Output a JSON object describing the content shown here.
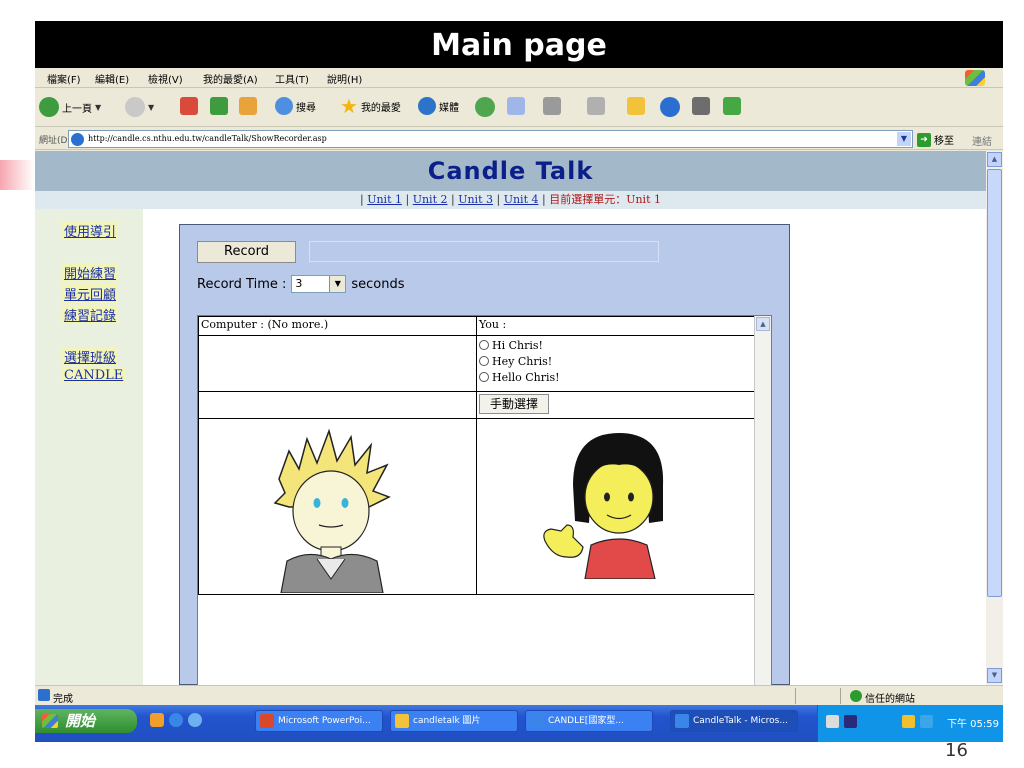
{
  "slide": {
    "title": "Main page",
    "page_number": "16"
  },
  "colors": {
    "title_bar": "#000000",
    "xp_chrome": "#ece9d8",
    "candle_header": "#a3b8c8",
    "candle_title": "#0b1f8a",
    "panel_bg": "#b9c9ea",
    "current_unit": "#b01616",
    "taskbar_blue": "#2454cf"
  },
  "browser": {
    "menu": [
      "檔案(F)",
      "編輯(E)",
      "檢視(V)",
      "我的最愛(A)",
      "工具(T)",
      "說明(H)"
    ],
    "toolbar": {
      "back": "上一頁",
      "search": "搜尋",
      "favorites": "我的最愛",
      "media": "媒體"
    },
    "address": {
      "label": "網址(D)",
      "url": "http://candle.cs.nthu.edu.tw/candleTalk/ShowRecorder.asp",
      "go": "移至",
      "links": "連結"
    },
    "status": {
      "text": "完成",
      "zone": "信任的網站"
    }
  },
  "candle": {
    "title": "Candle Talk",
    "units": [
      "Unit 1",
      "Unit 2",
      "Unit 3",
      "Unit 4"
    ],
    "current_unit_label": "目前選擇單元：Unit 1",
    "nav": [
      "使用導引",
      "開始練習",
      "單元回顧",
      "練習記錄",
      "選擇班級",
      "CANDLE"
    ],
    "record_button": "Record",
    "record_time_label": "Record Time :",
    "record_time_value": "3",
    "record_time_unit": "seconds",
    "computer_header": "Computer : (No more.)",
    "you_header": "You :",
    "choices": [
      "Hi Chris!",
      "Hey Chris!",
      "Hello Chris!"
    ],
    "manual_select": "手動選擇"
  },
  "taskbar": {
    "start": "開始",
    "tasks": [
      "Microsoft PowerPoi...",
      "candletalk 圖片",
      "CANDLE[國家型...",
      "CandleTalk - Micros..."
    ],
    "clock": "下午 05:59"
  }
}
